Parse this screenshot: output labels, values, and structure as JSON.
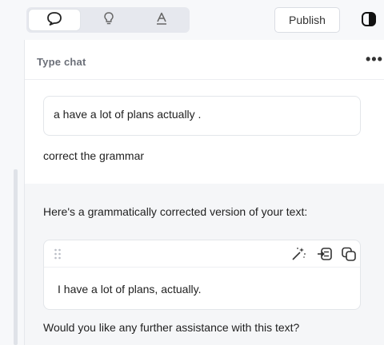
{
  "toolbar": {
    "modes": [
      {
        "icon": "chat-bubble-icon",
        "active": true
      },
      {
        "icon": "lightbulb-icon",
        "active": false
      },
      {
        "icon": "text-style-icon",
        "active": false
      }
    ],
    "publish_label": "Publish",
    "contrast_icon": "contrast-icon"
  },
  "chat": {
    "title": "Type chat",
    "more_icon": "more-icon",
    "more_label": "•••",
    "user_message": "a have a lot of plans actually .",
    "user_prompt": "correct the grammar",
    "response": {
      "intro": "Here's a grammatically corrected version of your text:",
      "card_tools": [
        "drag-handle-icon",
        "magic-wand-icon",
        "insert-icon",
        "copy-icon"
      ],
      "corrected_text": "I have a lot of plans, actually.",
      "followup": "Would you like any further assistance with this text?"
    }
  }
}
